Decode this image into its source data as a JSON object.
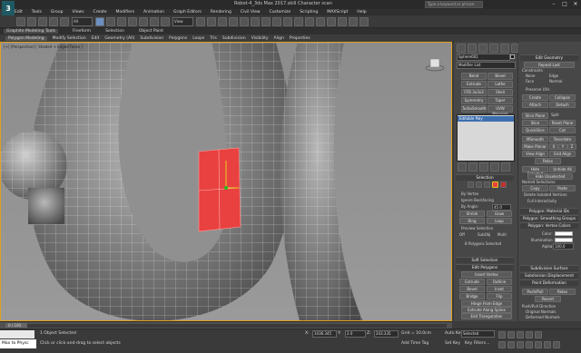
{
  "window": {
    "title": "Robot-4_3ds Max 2017.skill    Character scan",
    "help_search_placeholder": "Type a keyword or phrase",
    "logo": "3",
    "minimize": "–",
    "maximize": "□",
    "close": "✕"
  },
  "menubar": [
    "Edit",
    "Tools",
    "Group",
    "Views",
    "Create",
    "Modifiers",
    "Animation",
    "Graph Editors",
    "Rendering",
    "Civil View",
    "Customize",
    "Scripting",
    "MAXScript",
    "Help"
  ],
  "toolbar": {
    "selection_filter": "All",
    "view_dropdown": "View",
    "icons": [
      "undo-icon",
      "redo-icon",
      "link-icon",
      "unlink-icon",
      "bind-icon",
      "select-icon",
      "select-by-name-icon",
      "rect-select-icon",
      "window-crossing-icon",
      "move-icon",
      "rotate-icon",
      "scale-icon",
      "snap-icon",
      "angle-snap-icon",
      "percent-snap-icon",
      "mirror-icon",
      "align-icon",
      "layer-icon",
      "graphite-icon",
      "curve-editor-icon",
      "schematic-icon",
      "material-icon",
      "render-setup-icon",
      "render-frame-icon",
      "render-icon"
    ]
  },
  "ribbon": {
    "tabs": [
      "Graphite Modeling Tools",
      "Freeform",
      "Selection",
      "Object Paint"
    ],
    "row": [
      "Polygon Modeling",
      "Modify Selection",
      "Edit",
      "Geometry (All)",
      "Subdivision",
      "Polygons",
      "Loops",
      "Tris",
      "Subdivision",
      "Visibility",
      "Align",
      "Properties"
    ]
  },
  "viewport": {
    "label": "[+] [Perspective] [ Shaded + Edged Faces ]"
  },
  "command_panel": {
    "object_name": "Sphere001",
    "modifier_list": "Modifier List",
    "quick_buttons": [
      "Bend",
      "Bevel",
      "Extrude",
      "Lathe",
      "FFD 3x3x3",
      "Shell",
      "Symmetry",
      "Taper",
      "TurboSmooth",
      "UVW Mapping Cl..."
    ],
    "stack_item": "Editable Poly",
    "selection": {
      "header": "Selection",
      "by_vertex": "By Vertex",
      "ignore_backfacing": "Ignore Backfacing",
      "by_angle": "By Angle:",
      "by_angle_value": "45.0",
      "shrink": "Shrink",
      "grow": "Grow",
      "ring": "Ring",
      "loop": "Loop",
      "preview_selection": "Preview Selection",
      "off": "Off",
      "subobj": "SubObj",
      "multi": "Multi",
      "selected_count": "8 Polygons Selected"
    },
    "soft_selection": "Soft Selection",
    "edit_polygons": {
      "header": "Edit Polygons",
      "insert_vertex": "Insert Vertex",
      "extrude": "Extrude",
      "outline": "Outline",
      "bevel": "Bevel",
      "inset": "Inset",
      "bridge": "Bridge",
      "flip": "Flip",
      "hinge_from_edge": "Hinge From Edge",
      "extrude_along_spline": "Extrude Along Spline",
      "edit_triangulation": "Edit Triangulation",
      "retriangulate": "Retriangulate",
      "turn": "Turn"
    },
    "edit_geometry": {
      "header": "Edit Geometry",
      "repeat_last": "Repeat Last",
      "constraints": "Constraints",
      "none": "None",
      "edge": "Edge",
      "face": "Face",
      "normal": "Normal",
      "preserve_uvs": "Preserve UVs",
      "create": "Create",
      "collapse": "Collapse",
      "attach": "Attach",
      "detach": "Detach",
      "slice_plane": "Slice Plane",
      "split": "Split",
      "slice": "Slice",
      "reset_plane": "Reset Plane",
      "quickslice": "QuickSlice",
      "cut": "Cut",
      "msmooth": "MSmooth",
      "tessellate": "Tessellate",
      "make_planar": "Make Planar",
      "x": "X",
      "y": "Y",
      "z": "Z",
      "view_align": "View Align",
      "grid_align": "Grid Align",
      "relax": "Relax",
      "hide_selected": "Hide Selected",
      "unhide_all": "Unhide All",
      "hide_unselected": "Hide Unselected",
      "named_selections": "Named Selections:",
      "copy": "Copy",
      "paste": "Paste",
      "delete_isolated": "Delete Isolated Vertices",
      "full_interactivity": "Full Interactivity"
    },
    "material_ids": "Polygon: Material IDs",
    "smoothing_groups": "Polygon: Smoothing Groups",
    "vertex_colors": {
      "header": "Polygon: Vertex Colors",
      "color": "Color:",
      "illumination": "Illumination:",
      "alpha": "Alpha:",
      "alpha_value": "100.0"
    },
    "subdivision_surface": "Subdivision Surface",
    "subdivision_displacement": "Subdivision Displacement",
    "paint_deformation": {
      "header": "Paint Deformation",
      "pushpull": "Push/Pull",
      "relax": "Relax",
      "revert": "Revert",
      "direction": "Push/Pull Direction",
      "original_normals": "Original Normals",
      "deformed_normals": "Deformed Normals",
      "transform_axis": "Transform axis"
    }
  },
  "timeline": {
    "frame": "0 / 100"
  },
  "status": {
    "maxscript": "Max to Physc",
    "selected": "1 Object Selected",
    "prompt": "Click or click-and-drag to select objects",
    "x_label": "X:",
    "x_value": "1036.345",
    "y_label": "Y:",
    "y_value": "2.0",
    "z_label": "Z:",
    "z_value": "243.335",
    "grid": "Grid = 10.0cm",
    "add_time_tag": "Add Time Tag",
    "auto_key": "Auto Key",
    "set_key": "Set Key",
    "selected_dropdown": "Selected",
    "key_filters": "Key Filters..."
  },
  "colors": {
    "selection_red": "#e8413f",
    "accent_yellow": "#e0a020",
    "stack_blue": "#3d6fb0"
  }
}
